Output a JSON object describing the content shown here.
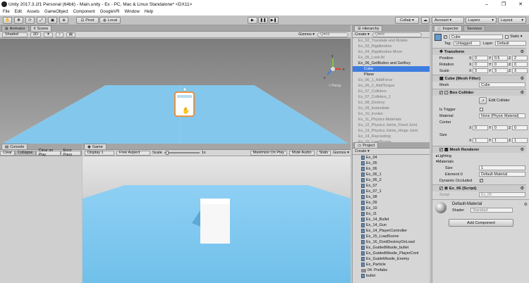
{
  "window": {
    "title": "Unity 2017.3.1f1 Personal (64bit) - Main.unity - Ex - PC, Mac & Linux Standalone* <DX11>",
    "controls": [
      "–",
      "❐",
      "✕"
    ]
  },
  "menu": [
    "File",
    "Edit",
    "Assets",
    "GameObject",
    "Component",
    "GoogleVR",
    "Window",
    "Help"
  ],
  "toolbar": {
    "pivot": "Pivot",
    "local": "Local",
    "collab": "Collab ▾",
    "account": "Account ▾",
    "layers": "Layers",
    "layout": "Layout",
    "cloud_icon": "cloud-icon"
  },
  "scene": {
    "tabs": [
      "Animator",
      "Scene"
    ],
    "shaded": "Shaded",
    "mode2d": "2D",
    "gizmos": "Gizmos ▾",
    "search": "Q▾All",
    "persp": "< Persp"
  },
  "hierarchy": {
    "tab": "Hierarchy",
    "create": "Create ▾",
    "search": "Q▾All",
    "rows": [
      {
        "label": "Ex_02_Translate and Rotate",
        "indent": 1,
        "style": "dim"
      },
      {
        "label": "Ex_03_Rigidbodies",
        "indent": 1,
        "style": "dim"
      },
      {
        "label": "Ex_04_Rigidbodies Move",
        "indent": 1,
        "style": "dim"
      },
      {
        "label": "Ex_05_Look At",
        "indent": 1,
        "style": "dim"
      },
      {
        "label": "Ex_06_GetButton and GetKey",
        "indent": 1,
        "style": "blk"
      },
      {
        "label": "Cube",
        "indent": 2,
        "style": "sel"
      },
      {
        "label": "Plane",
        "indent": 2,
        "style": "blk"
      },
      {
        "label": "Ex_06_1_AddForce",
        "indent": 1,
        "style": "dim"
      },
      {
        "label": "Ex_06_2_AddTorque",
        "indent": 1,
        "style": "dim"
      },
      {
        "label": "Ex_07_Colliders",
        "indent": 1,
        "style": "dim"
      },
      {
        "label": "Ex_07_Colliders_1",
        "indent": 1,
        "style": "dim"
      },
      {
        "label": "Ex_08_Destroy",
        "indent": 1,
        "style": "dim"
      },
      {
        "label": "Ex_09_Instantiate",
        "indent": 1,
        "style": "dim"
      },
      {
        "label": "Ex_10_Invoke",
        "indent": 1,
        "style": "dim"
      },
      {
        "label": "Ex_11_Physics Materials",
        "indent": 1,
        "style": "dim"
      },
      {
        "label": "Ex_12_Physics Joints_Fixed Joint",
        "indent": 1,
        "style": "dim"
      },
      {
        "label": "Ex_13_Physics Joints_Hinge Joint",
        "indent": 1,
        "style": "dim"
      },
      {
        "label": "Ex_14_Raycasting",
        "indent": 1,
        "style": "dim"
      },
      {
        "label": "Ex_15_LoadScene",
        "indent": 1,
        "style": "dim"
      }
    ]
  },
  "console": {
    "tab": "Console",
    "buttons": [
      "Clear",
      "Collapse",
      "Clear on Play",
      "Error Paus"
    ]
  },
  "game": {
    "tab": "Game",
    "display": "Display 1",
    "aspect": "Free Aspect",
    "scale_label": "Scale",
    "scale_value": "1x",
    "scale_level": 0.05,
    "buttons": [
      "Maximize On Play",
      "Mute Audio",
      "Stats",
      "Gizmos ▾"
    ]
  },
  "project": {
    "tab": "Project",
    "create": "Create ▾",
    "items": [
      {
        "label": "Ex_04",
        "type": "file"
      },
      {
        "label": "Ex_05",
        "type": "file"
      },
      {
        "label": "Ex_06",
        "type": "file"
      },
      {
        "label": "Ex_06_1",
        "type": "file"
      },
      {
        "label": "Ex_06_2",
        "type": "file"
      },
      {
        "label": "Ex_07",
        "type": "file"
      },
      {
        "label": "Ex_07_1",
        "type": "file"
      },
      {
        "label": "Ex_08",
        "type": "file"
      },
      {
        "label": "Ex_09",
        "type": "file"
      },
      {
        "label": "Ex_10",
        "type": "file"
      },
      {
        "label": "Ex_11",
        "type": "file"
      },
      {
        "label": "Ex_14_Bullet",
        "type": "file"
      },
      {
        "label": "Ex_14_Gun",
        "type": "file"
      },
      {
        "label": "Ex_14_PlayerController",
        "type": "file"
      },
      {
        "label": "Ex_15_LoadScene",
        "type": "file"
      },
      {
        "label": "Ex_16_DontDestroyOnLoad",
        "type": "file"
      },
      {
        "label": "Ex_GuidedMissile_bullet",
        "type": "file"
      },
      {
        "label": "Ex_GuidedMissile_PlayerCont",
        "type": "file"
      },
      {
        "label": "Ex_GuideMissile_Enemy",
        "type": "file"
      },
      {
        "label": "Ex_Particle",
        "type": "file"
      },
      {
        "label": "04. Prefabs",
        "type": "folder"
      },
      {
        "label": "bullet",
        "type": "file"
      }
    ]
  },
  "inspector": {
    "tabs": [
      "Inspector",
      "Services"
    ],
    "object": {
      "name": "Cube",
      "static": "Static ▾",
      "tag_label": "Tag",
      "tag": "Untagged",
      "layer_label": "Layer",
      "layer": "Default"
    },
    "transform": {
      "title": "Transform",
      "position_label": "Position",
      "rotation_label": "Rotation",
      "scale_label": "Scale",
      "position": [
        "0",
        "0.5",
        "2"
      ],
      "rotation": [
        "0",
        "0",
        "0"
      ],
      "scale": [
        "3",
        "3",
        "3"
      ]
    },
    "mesh_filter": {
      "title": "Cube (Mesh Filter)",
      "mesh_label": "Mesh",
      "mesh": "Cube"
    },
    "box_collider": {
      "title": "Box Collider",
      "edit_collider": "Edit Collider",
      "is_trigger": "Is Trigger",
      "material_label": "Material",
      "material": "None (Physic Material)",
      "center_label": "Center",
      "center": [
        "0",
        "0",
        "0"
      ],
      "size_label": "Size",
      "size": [
        "1",
        "1",
        "1"
      ]
    },
    "mesh_renderer": {
      "title": "Mesh Renderer",
      "lighting": "Lighting",
      "materials": "Materials",
      "size_label": "Size",
      "size": "1",
      "element0_label": "Element 0",
      "element0": "Default-Material",
      "dynamic_occluded": "Dynamic Occluded"
    },
    "script": {
      "title": "Ex_06 (Script)",
      "script_label": "Script",
      "script": "Ex_06"
    },
    "material": {
      "name": "Default-Material",
      "shader_label": "Shader",
      "shader": "Standard"
    },
    "add_component": "Add Component"
  },
  "colors": {
    "sky": "#8fd0f4",
    "ground": "#77c4ea",
    "selection": "#3e7de0",
    "cube_outline": "#f08a2c"
  },
  "axis_labels": {
    "x": "x",
    "y": "y",
    "z": "z"
  }
}
